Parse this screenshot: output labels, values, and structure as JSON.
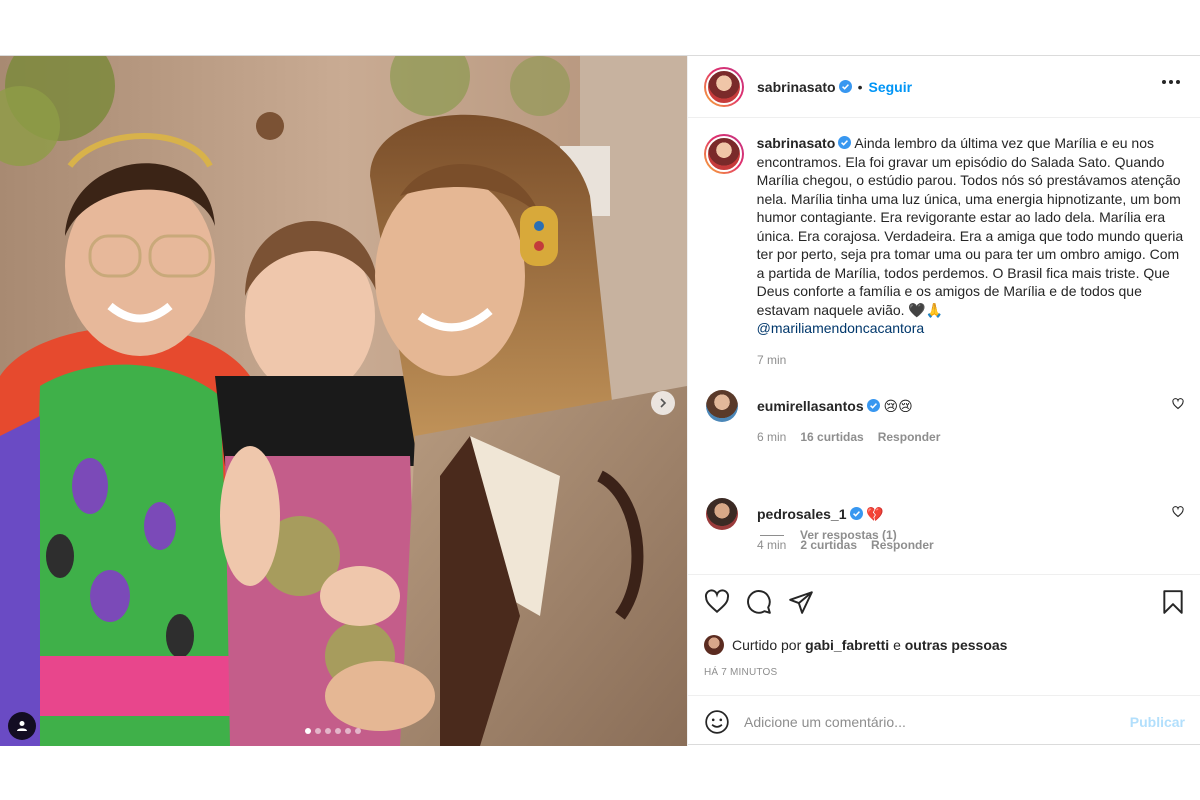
{
  "post": {
    "username": "sabrinasato",
    "separator": "•",
    "follow_label": "Seguir",
    "caption_text": "Ainda lembro da última vez que Marília e eu nos encontramos. Ela foi gravar um episódio do Salada Sato. Quando Marília chegou, o estúdio parou. Todos nós só prestávamos atenção nela. Marília tinha uma luz única, uma energia hipnotizante, um bom humor contagiante. Era revigorante estar ao lado dela. Marília era única. Era corajosa. Verdadeira. Era a amiga que todo mundo queria ter por perto, seja pra tomar uma ou para ter um ombro amigo. Com a partida de Marília, todos perdemos. O Brasil fica mais triste. Que Deus conforte a família e os amigos de Marília e de todos que estavam naquele avião. 🖤🙏",
    "caption_mention": "@mariliamendoncacantora",
    "caption_time": "7 min",
    "carousel": {
      "total": 6,
      "active": 0
    }
  },
  "comments": [
    {
      "username": "eumirellasantos",
      "text": "😢😢",
      "time": "6 min",
      "likes": "16 curtidas",
      "reply": "Responder"
    },
    {
      "username": "pedrosales_1",
      "text": "💔",
      "time": "4 min",
      "likes": "2 curtidas",
      "reply": "Responder"
    }
  ],
  "view_replies": "Ver respostas (1)",
  "likes_line": {
    "prefix": "Curtido por",
    "user": "gabi_fabretti",
    "conj": "e",
    "others": "outras pessoas"
  },
  "post_time": "HÁ 7 MINUTOS",
  "comment_box": {
    "placeholder": "Adicione um comentário...",
    "publish_label": "Publicar"
  },
  "colors": {
    "accent": "#0095f6",
    "publish_disabled": "#b2dffc",
    "meta": "#8e8e8e",
    "heart": "#ed4956"
  },
  "icons": [
    "heart-icon",
    "comment-icon",
    "share-icon",
    "bookmark-icon",
    "emoji-icon",
    "more-icon",
    "chevron-right-icon",
    "user-tag-icon",
    "verified-icon"
  ]
}
